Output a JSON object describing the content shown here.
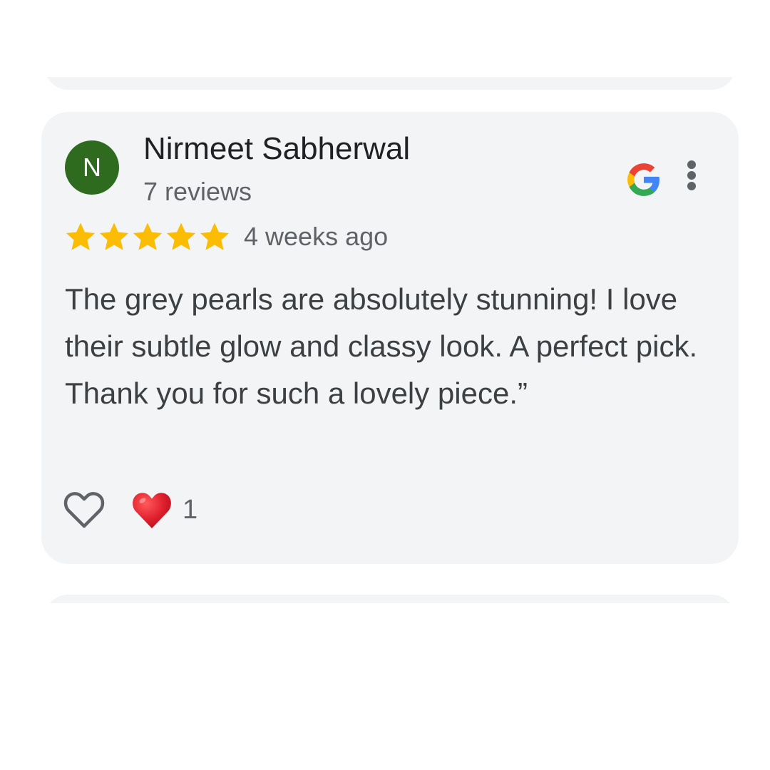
{
  "review": {
    "avatar_initial": "N",
    "reviewer_name": "Nirmeet Sabherwal",
    "review_count": "7 reviews",
    "rating": 5,
    "rating_max": 5,
    "time_ago": "4 weeks ago",
    "text": "The grey pearls are absolutely stunning! I love their subtle glow and classy look. A perfect pick. Thank you for such a lovely piece.”",
    "reaction_count": "1",
    "source_icon": "google-g-icon",
    "more_icon": "more-vertical-icon",
    "like_icon": "heart-outline-icon",
    "reaction_icon": "red-heart-icon"
  },
  "colors": {
    "card_background": "#f3f4f6",
    "avatar_background": "#2f6b1f",
    "star": "#fbbc04",
    "reaction_heart": "#e0202e"
  }
}
